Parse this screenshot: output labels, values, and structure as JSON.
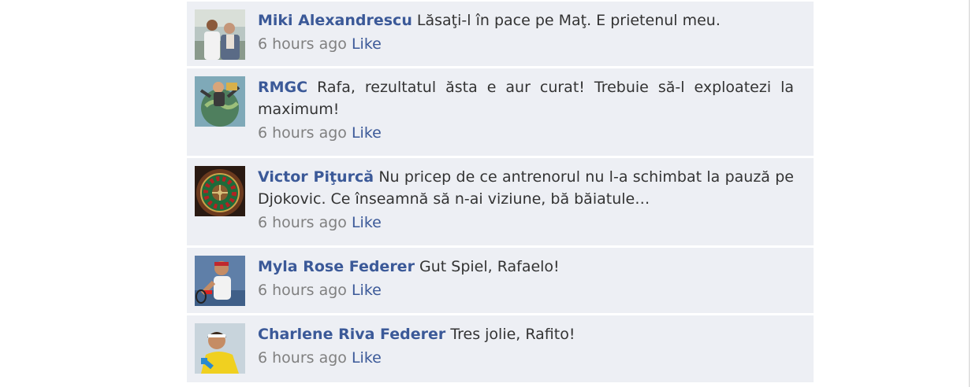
{
  "comments": [
    {
      "author": "Miki Alexandrescu",
      "text": "Lăsaţi-l în pace pe Maţ. E prietenul meu.",
      "time": "6 hours ago",
      "like": "Like",
      "avatar_icon": "two-men-photo-icon"
    },
    {
      "author": "RMGC",
      "text": "Rafa, rezultatul ăsta e aur curat! Trebuie să-l exploatezi la maximum!",
      "time": "6 hours ago",
      "like": "Like",
      "avatar_icon": "globe-man-caricature-icon"
    },
    {
      "author": "Victor Piţurcă",
      "text": "Nu pricep de ce antrenorul nu l-a schimbat la pauză pe Djokovic. Ce înseamnă să n-ai viziune, bă băiatule…",
      "time": "6 hours ago",
      "like": "Like",
      "avatar_icon": "roulette-wheel-icon"
    },
    {
      "author": "Myla Rose Federer",
      "text": "Gut Spiel, Rafaelo!",
      "time": "6 hours ago",
      "like": "Like",
      "avatar_icon": "tennis-player-photo-icon"
    },
    {
      "author": "Charlene Riva Federer",
      "text": "Tres jolie, Rafito!",
      "time": "6 hours ago",
      "like": "Like",
      "avatar_icon": "tennis-player-yellow-photo-icon"
    }
  ]
}
